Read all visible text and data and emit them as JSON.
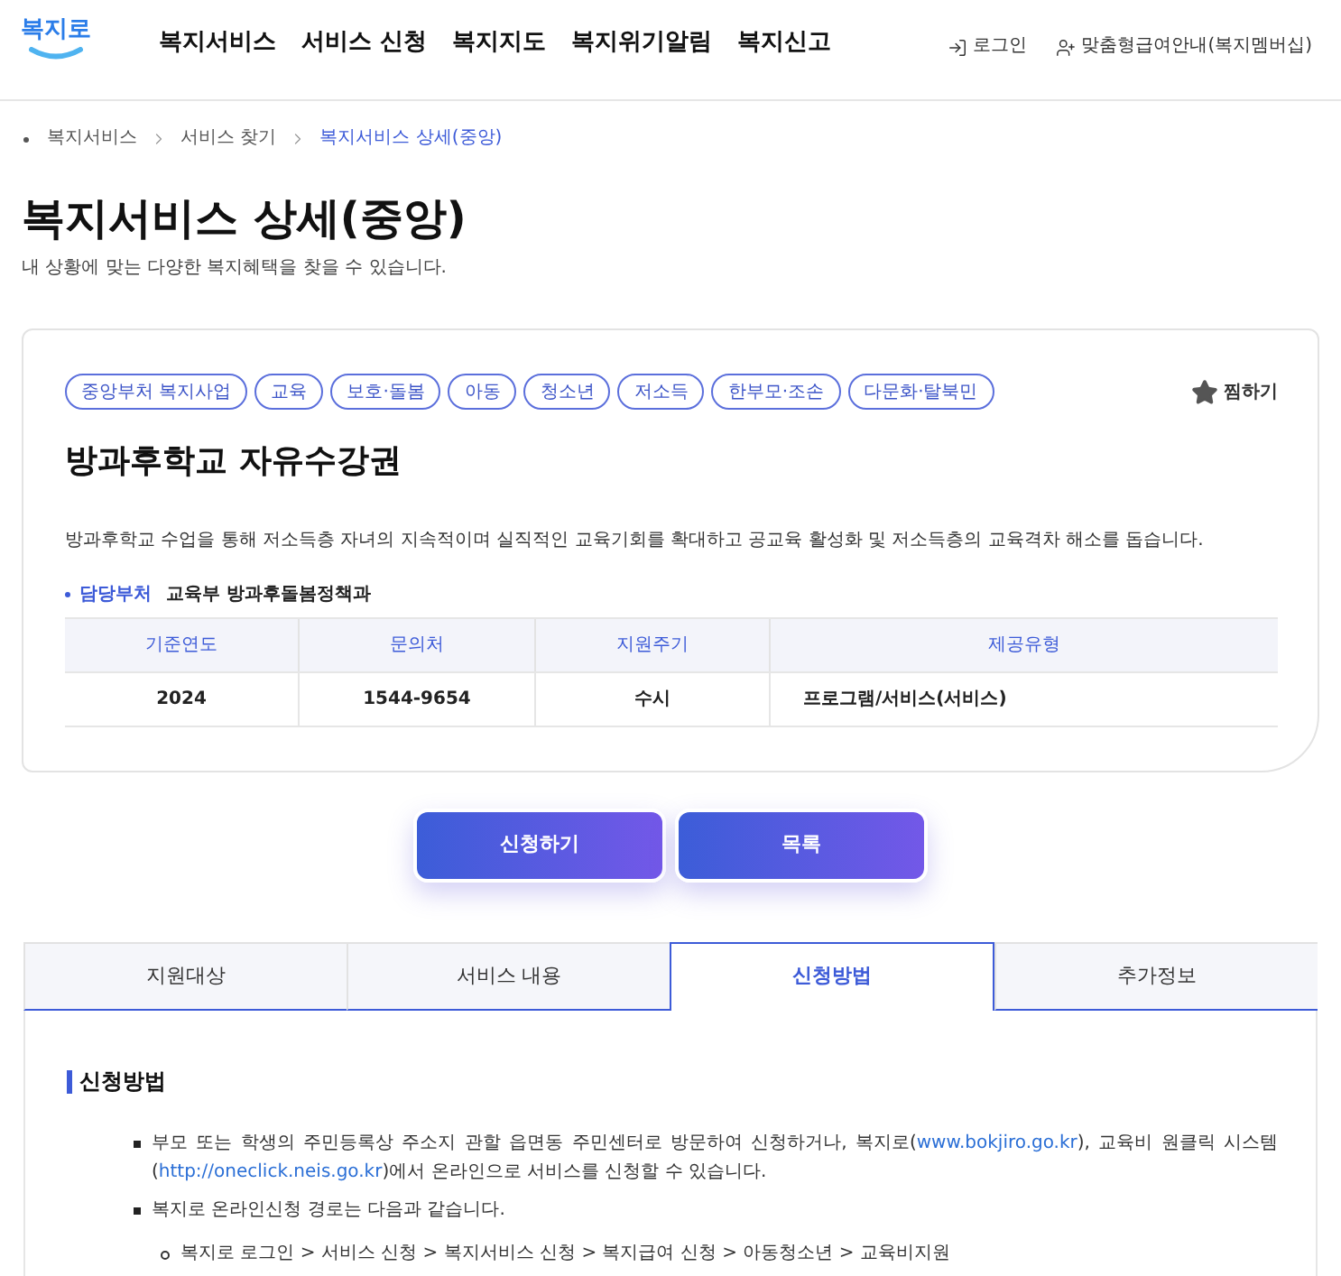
{
  "header": {
    "logo_text": "복지로",
    "nav": [
      "복지서비스",
      "서비스 신청",
      "복지지도",
      "복지위기알림",
      "복지신고"
    ],
    "login": {
      "label": "로그인"
    },
    "membership": {
      "label": "맞춤형급여안내(복지멤버십)"
    }
  },
  "breadcrumb": [
    {
      "label": "복지서비스",
      "current": false
    },
    {
      "label": "서비스 찾기",
      "current": false
    },
    {
      "label": "복지서비스 상세(중앙)",
      "current": true
    }
  ],
  "page": {
    "title": "복지서비스 상세(중앙)",
    "subtitle": "내 상황에 맞는 다양한 복지혜택을 찾을 수 있습니다."
  },
  "service": {
    "tags": [
      "중앙부처 복지사업",
      "교육",
      "보호·돌봄",
      "아동",
      "청소년",
      "저소득",
      "한부모·조손",
      "다문화·탈북민"
    ],
    "wishlist": {
      "label": "찜하기"
    },
    "title": "방과후학교 자유수강권",
    "description": "방과후학교 수업을 통해 저소득층 자녀의 지속적이며 실직적인 교육기회를 확대하고 공교육 활성화 및 저소득층의 교육격차 해소를 돕습니다.",
    "department": {
      "label": "담당부처",
      "value": "교육부 방과후돌봄정책과"
    },
    "info_table": {
      "columns": [
        "기준연도",
        "문의처",
        "지원주기",
        "제공유형"
      ],
      "rows": [
        [
          "2024",
          "1544-9654",
          "수시",
          "프로그램/서비스(서비스)"
        ]
      ]
    }
  },
  "actions": [
    "신청하기",
    "목록"
  ],
  "tabs": [
    {
      "label": "지원대상",
      "selected": false
    },
    {
      "label": "서비스 내용",
      "selected": false
    },
    {
      "label": "신청방법",
      "selected": true
    },
    {
      "label": "추가정보",
      "selected": false
    }
  ],
  "content": {
    "heading": "신청방법",
    "items": [
      {
        "segments": [
          {
            "kind": "text",
            "text": "부모 또는 학생의 주민등록상 주소지 관할 읍면동 주민센터로 방문하여 신청하거나, 복지로("
          },
          {
            "kind": "link",
            "text": "www.bokjiro.go.kr"
          },
          {
            "kind": "text",
            "text": "), 교육비 원클릭 시스템 ("
          },
          {
            "kind": "link",
            "text": "http://oneclick.neis.go.kr"
          },
          {
            "kind": "text",
            "text": ")에서 온라인으로 서비스를 신청할 수 있습니다."
          }
        ]
      },
      {
        "segments": [
          {
            "kind": "text",
            "text": "복지로 온라인신청 경로는 다음과 같습니다."
          }
        ],
        "children": [
          {
            "segments": [
              {
                "kind": "text",
                "text": "복지로 로그인 > 서비스 신청 > 복지서비스 신청 > 복지급여 신청 > 아동청소년 > 교육비지원"
              }
            ]
          }
        ]
      }
    ]
  }
}
